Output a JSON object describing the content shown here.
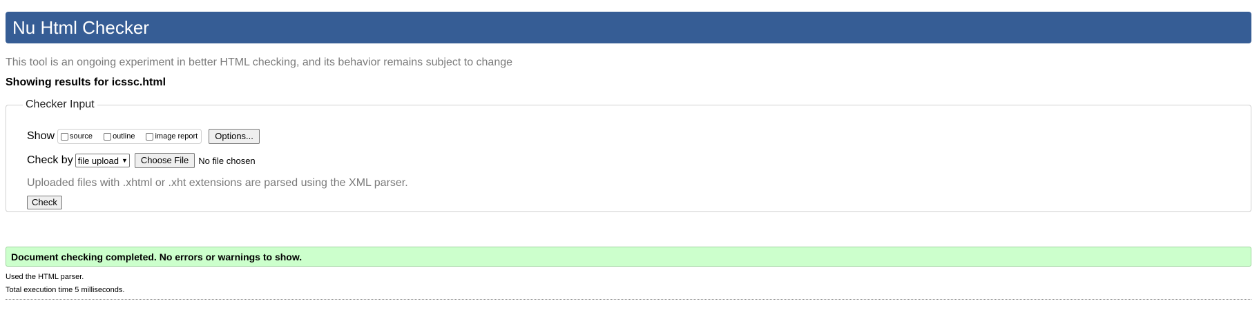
{
  "header": {
    "title": "Nu Html Checker"
  },
  "intro": "This tool is an ongoing experiment in better HTML checking, and its behavior remains subject to change",
  "results": {
    "prefix": "Showing results for ",
    "filename": "icssc.html"
  },
  "checker_input": {
    "legend": "Checker Input",
    "show_label": "Show",
    "show_options": [
      {
        "label": "source",
        "checked": false
      },
      {
        "label": "outline",
        "checked": false
      },
      {
        "label": "image report",
        "checked": false
      }
    ],
    "options_button": "Options...",
    "check_by_label": "Check by",
    "check_by_selected": "file upload",
    "choose_file_button": "Choose File",
    "file_status": "No file chosen",
    "note": "Uploaded files with .xhtml or .xht extensions are parsed using the XML parser.",
    "check_button": "Check"
  },
  "status": {
    "message": "Document checking completed. No errors or warnings to show.",
    "details": [
      "Used the HTML parser.",
      "Total execution time 5 milliseconds."
    ]
  }
}
